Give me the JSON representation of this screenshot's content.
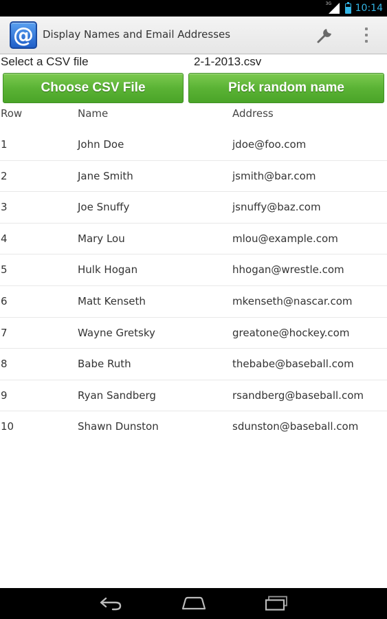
{
  "status_bar": {
    "network": "3G",
    "time": "10:14",
    "icons": [
      "signal-icon",
      "battery-icon"
    ]
  },
  "action_bar": {
    "app_icon_glyph": "@",
    "title": "Display Names and Email Addresses",
    "icons": [
      "app-icon",
      "wrench-icon",
      "overflow-menu-icon"
    ]
  },
  "file_select": {
    "label": "Select a CSV file",
    "file_name": "2-1-2013.csv"
  },
  "buttons": {
    "choose_csv": "Choose CSV File",
    "pick_random": "Pick random name"
  },
  "colors": {
    "button_green": "#5bb335",
    "status_accent": "#33b5e5"
  },
  "table": {
    "headers": {
      "row": "Row",
      "name": "Name",
      "address": "Address"
    },
    "rows": [
      {
        "row": "1",
        "name": "John Doe",
        "address": "jdoe@foo.com"
      },
      {
        "row": "2",
        "name": "Jane Smith",
        "address": "jsmith@bar.com"
      },
      {
        "row": "3",
        "name": "Joe Snuffy",
        "address": "jsnuffy@baz.com"
      },
      {
        "row": "4",
        "name": "Mary Lou",
        "address": "mlou@example.com"
      },
      {
        "row": "5",
        "name": "Hulk Hogan",
        "address": "hhogan@wrestle.com"
      },
      {
        "row": "6",
        "name": "Matt Kenseth",
        "address": "mkenseth@nascar.com"
      },
      {
        "row": "7",
        "name": "Wayne Gretsky",
        "address": "greatone@hockey.com"
      },
      {
        "row": "8",
        "name": "Babe Ruth",
        "address": "thebabe@baseball.com"
      },
      {
        "row": "9",
        "name": "Ryan Sandberg",
        "address": "rsandberg@baseball.com"
      },
      {
        "row": "10",
        "name": "Shawn Dunston",
        "address": "sdunston@baseball.com"
      }
    ]
  },
  "nav_bar": {
    "icons": [
      "back-icon",
      "home-icon",
      "recent-apps-icon"
    ]
  }
}
